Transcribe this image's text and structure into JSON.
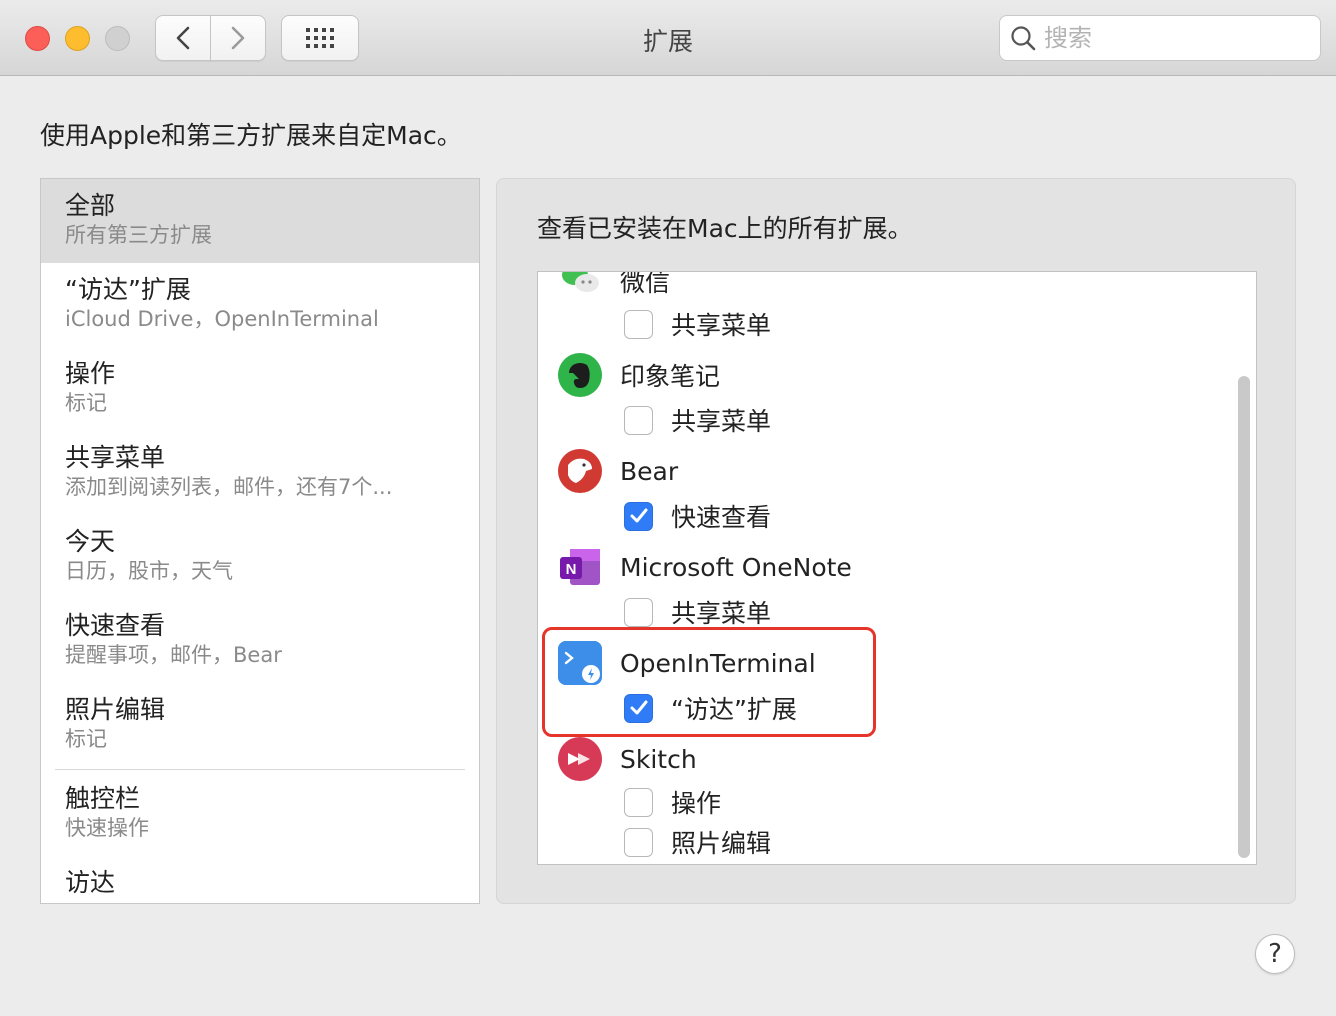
{
  "window": {
    "title": "扩展",
    "search_placeholder": "搜索"
  },
  "intro": "使用Apple和第三方扩展来自定Mac。",
  "sidebar": {
    "items": [
      {
        "title": "全部",
        "subtitle": "所有第三方扩展",
        "selected": true
      },
      {
        "title": "“访达”扩展",
        "subtitle": "iCloud Drive，OpenInTerminal"
      },
      {
        "title": "操作",
        "subtitle": "标记"
      },
      {
        "title": "共享菜单",
        "subtitle": "添加到阅读列表，邮件，还有7个..."
      },
      {
        "title": "今天",
        "subtitle": "日历，股市，天气"
      },
      {
        "title": "快速查看",
        "subtitle": "提醒事项，邮件，Bear"
      },
      {
        "title": "照片编辑",
        "subtitle": "标记"
      }
    ],
    "items_after_divider": [
      {
        "title": "触控栏",
        "subtitle": "快速操作"
      },
      {
        "title": "访达",
        "subtitle": ""
      }
    ]
  },
  "panel": {
    "description": "查看已安装在Mac上的所有扩展。",
    "apps": [
      {
        "name": "微信",
        "icon": "wechat-icon",
        "extensions": [
          {
            "label": "共享菜单",
            "checked": false
          }
        ]
      },
      {
        "name": "印象笔记",
        "icon": "evernote-icon",
        "extensions": [
          {
            "label": "共享菜单",
            "checked": false
          }
        ]
      },
      {
        "name": "Bear",
        "icon": "bear-icon",
        "extensions": [
          {
            "label": "快速查看",
            "checked": true
          }
        ]
      },
      {
        "name": "Microsoft OneNote",
        "icon": "onenote-icon",
        "extensions": [
          {
            "label": "共享菜单",
            "checked": false
          }
        ]
      },
      {
        "name": "OpenInTerminal",
        "icon": "terminal-icon",
        "extensions": [
          {
            "label": "“访达”扩展",
            "checked": true
          }
        ]
      },
      {
        "name": "Skitch",
        "icon": "skitch-icon",
        "extensions": [
          {
            "label": "操作",
            "checked": false
          },
          {
            "label": "照片编辑",
            "checked": false
          }
        ]
      }
    ]
  },
  "help_label": "?",
  "colors": {
    "accent": "#2f7cf6",
    "highlight": "#e5352a"
  }
}
